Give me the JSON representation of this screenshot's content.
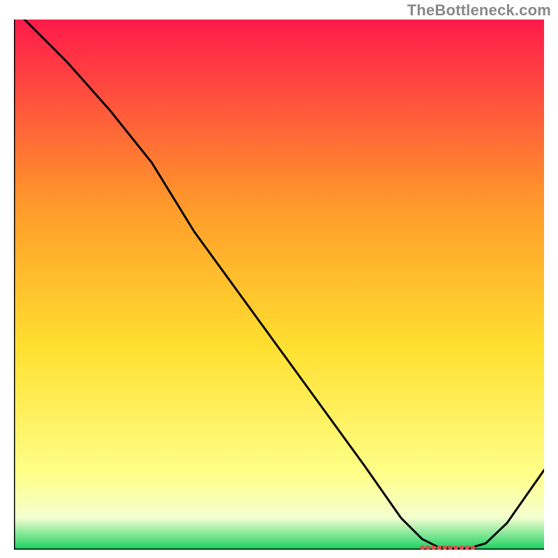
{
  "watermark": "TheBottleneck.com",
  "colors": {
    "gradient_top": "#ff1a4b",
    "gradient_upper_mid": "#ff9a2a",
    "gradient_mid": "#ffe030",
    "gradient_lower_mid": "#ffff8a",
    "gradient_bottom": "#18d060",
    "axis": "#000000",
    "curve": "#000000",
    "marker": "#d9534f"
  },
  "chart_data": {
    "type": "line",
    "title": "",
    "xlabel": "",
    "ylabel": "",
    "xlim": [
      0,
      100
    ],
    "ylim": [
      0,
      100
    ],
    "x": [
      2,
      10,
      18,
      26,
      34,
      42,
      50,
      58,
      66,
      73,
      77,
      80,
      83,
      86,
      89,
      93,
      100
    ],
    "values": [
      100,
      92,
      83,
      73,
      60,
      49,
      38,
      27,
      16,
      6,
      2,
      0.5,
      0.3,
      0.3,
      1.2,
      5,
      15
    ],
    "marker": {
      "x_start": 77,
      "x_end": 87,
      "y": 0.4
    },
    "grid": false,
    "legend": false
  }
}
